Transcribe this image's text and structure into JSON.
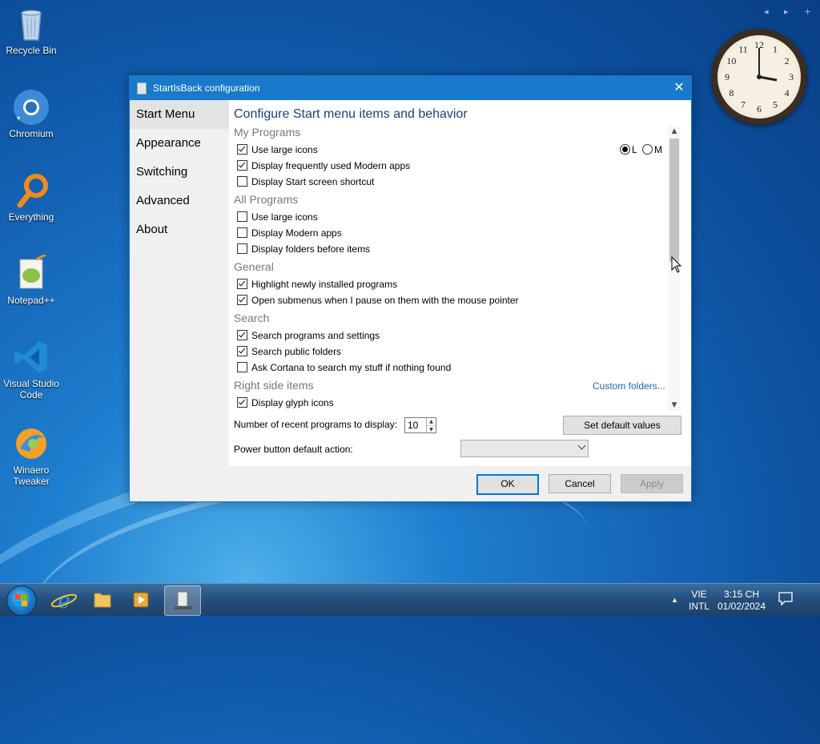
{
  "desktop": {
    "icons": [
      {
        "label": "Recycle Bin"
      },
      {
        "label": "Chromium"
      },
      {
        "label": "Everything"
      },
      {
        "label": "Notepad++"
      },
      {
        "label": "Visual Studio Code"
      },
      {
        "label": "Winaero Tweaker"
      }
    ]
  },
  "gadget": {
    "clock_time": "3:15",
    "numbers": [
      "12",
      "1",
      "2",
      "3",
      "4",
      "5",
      "6",
      "7",
      "8",
      "9",
      "10",
      "11"
    ],
    "nav": "◂ ▸ +"
  },
  "dialog": {
    "title": "StartIsBack configuration",
    "close": "✕",
    "sidebar": {
      "items": [
        {
          "label": "Start Menu",
          "active": true
        },
        {
          "label": "Appearance"
        },
        {
          "label": "Switching"
        },
        {
          "label": "Advanced"
        },
        {
          "label": "About"
        }
      ]
    },
    "heading": "Configure Start menu items and behavior",
    "sections": {
      "my_programs": {
        "title": "My Programs",
        "items": [
          {
            "label": "Use large icons",
            "checked": true
          },
          {
            "label": "Display frequently used Modern apps",
            "checked": true
          },
          {
            "label": "Display Start screen shortcut",
            "checked": false
          }
        ],
        "size_options": [
          {
            "label": "L",
            "selected": true
          },
          {
            "label": "M",
            "selected": false
          }
        ]
      },
      "all_programs": {
        "title": "All Programs",
        "items": [
          {
            "label": "Use large icons",
            "checked": false
          },
          {
            "label": "Display Modern apps",
            "checked": false
          },
          {
            "label": "Display folders before items",
            "checked": false
          }
        ]
      },
      "general": {
        "title": "General",
        "items": [
          {
            "label": "Highlight newly installed programs",
            "checked": true
          },
          {
            "label": "Open submenus when I pause on them with the mouse pointer",
            "checked": true
          }
        ]
      },
      "search": {
        "title": "Search",
        "items": [
          {
            "label": "Search programs and settings",
            "checked": true
          },
          {
            "label": "Search public folders",
            "checked": true
          },
          {
            "label": "Ask Cortana to search my stuff if nothing found",
            "checked": false
          }
        ]
      },
      "right_side": {
        "title": "Right side items",
        "link": "Custom folders...",
        "items": [
          {
            "label": "Display glyph icons",
            "checked": true
          }
        ]
      }
    },
    "recent_programs": {
      "label": "Number of recent programs to display:",
      "value": "10"
    },
    "set_default": "Set default values",
    "power_button": {
      "label": "Power button default action:",
      "value": ""
    },
    "buttons": {
      "ok": "OK",
      "cancel": "Cancel",
      "apply": "Apply"
    }
  },
  "taskbar": {
    "lang_top": "VIE",
    "lang_bottom": "INTL",
    "time": "3:15 CH",
    "date": "01/02/2024",
    "tray_arrow": "▲"
  }
}
